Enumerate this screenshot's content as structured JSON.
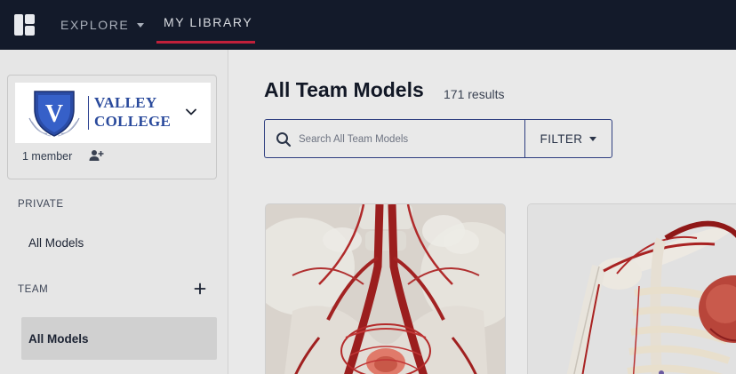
{
  "topnav": {
    "explore_label": "EXPLORE",
    "library_label": "MY LIBRARY"
  },
  "sidebar": {
    "org": {
      "name_line1": "VALLEY",
      "name_line2": "COLLEGE",
      "logo_letter": "V",
      "member_count": "1 member"
    },
    "private_label": "PRIVATE",
    "private_all_models": "All Models",
    "team_label": "TEAM",
    "team_all_models": "All Models"
  },
  "main": {
    "title": "All Team Models",
    "result_count": "171 results",
    "search_placeholder": "Search All Team Models",
    "filter_label": "FILTER"
  },
  "icons": {
    "logo": "app-logo-icon",
    "explore_caret": "caret-down-icon",
    "org_chevron": "chevron-down-icon",
    "add_member": "add-person-icon",
    "team_add": "plus-icon",
    "search": "search-icon",
    "filter_caret": "caret-down-icon"
  },
  "colors": {
    "topnav_bg": "#131a2a",
    "active_underline": "#c0203a",
    "brand_blue": "#2a4a9c",
    "input_border": "#2f3f80"
  }
}
